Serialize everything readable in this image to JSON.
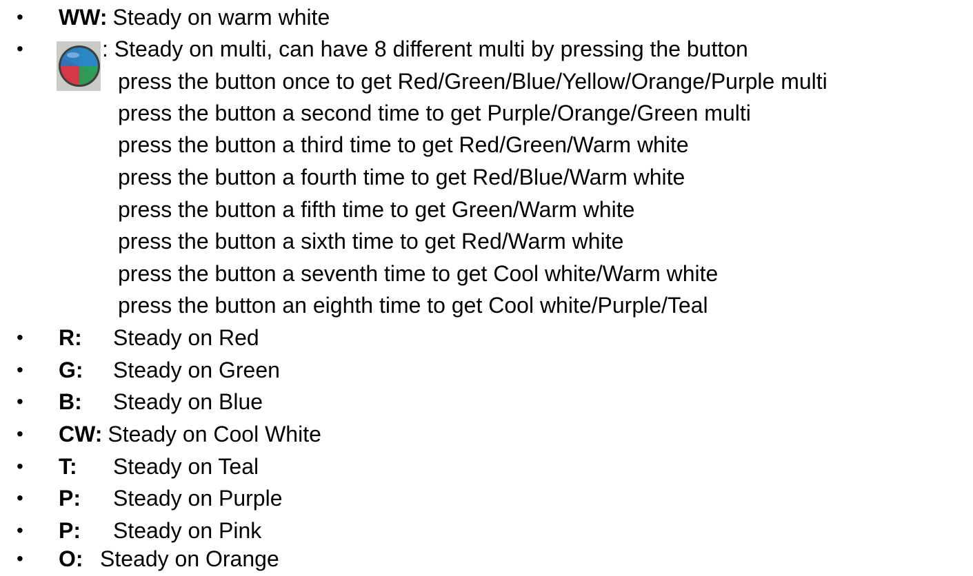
{
  "items_top": [
    {
      "code": "WW:",
      "text": "Steady on warm white"
    }
  ],
  "multi": {
    "icon": "multi-color-button-icon",
    "text": ": Steady on multi, can have 8 different multi by pressing the button",
    "steps": [
      "press the button once to get Red/Green/Blue/Yellow/Orange/Purple multi",
      "press the button a second time to get Purple/Orange/Green multi",
      "press the button a third time to get Red/Green/Warm white",
      "press the button a fourth time to get Red/Blue/Warm white",
      "press the button a fifth time to get Green/Warm white",
      "press the button a sixth time to get Red/Warm white",
      "press the button a seventh time to get Cool white/Warm white",
      "press the button an eighth time to get Cool white/Purple/Teal"
    ]
  },
  "items_bottom": [
    {
      "code": "R:",
      "text": "Steady on Red"
    },
    {
      "code": "G:",
      "text": "Steady on Green"
    },
    {
      "code": "B:",
      "text": "Steady on Blue"
    },
    {
      "code": "CW:",
      "text": "Steady on Cool White"
    },
    {
      "code": "T:",
      "text": "Steady on Teal"
    },
    {
      "code": "P:",
      "text": "Steady on Purple"
    },
    {
      "code": "P:",
      "text": "Steady on Pink"
    },
    {
      "code": "O:",
      "text": "Steady on Orange"
    }
  ],
  "bullet_char": "•"
}
